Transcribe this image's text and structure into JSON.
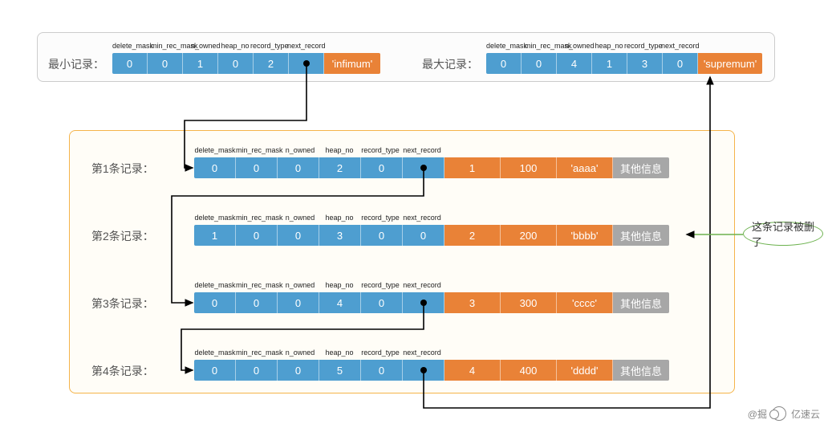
{
  "headers": [
    "delete_mask",
    "min_rec_mask",
    "n_owned",
    "heap_no",
    "record_type",
    "next_record"
  ],
  "top": {
    "min": {
      "label": "最小记录：",
      "cells": [
        "0",
        "0",
        "1",
        "0",
        "2",
        ""
      ],
      "tail": "'infimum'"
    },
    "max": {
      "label": "最大记录：",
      "cells": [
        "0",
        "0",
        "4",
        "1",
        "3",
        "0"
      ],
      "tail": "'supremum'"
    }
  },
  "records": [
    {
      "label": "第1条记录：",
      "blue": [
        "0",
        "0",
        "0",
        "2",
        "0",
        ""
      ],
      "orange": [
        "1",
        "100",
        "'aaaa'"
      ],
      "grey": "其他信息"
    },
    {
      "label": "第2条记录：",
      "blue": [
        "1",
        "0",
        "0",
        "3",
        "0",
        "0"
      ],
      "orange": [
        "2",
        "200",
        "'bbbb'"
      ],
      "grey": "其他信息"
    },
    {
      "label": "第3条记录：",
      "blue": [
        "0",
        "0",
        "0",
        "4",
        "0",
        ""
      ],
      "orange": [
        "3",
        "300",
        "'cccc'"
      ],
      "grey": "其他信息"
    },
    {
      "label": "第4条记录：",
      "blue": [
        "0",
        "0",
        "0",
        "5",
        "0",
        ""
      ],
      "orange": [
        "4",
        "400",
        "'dddd'"
      ],
      "grey": "其他信息"
    }
  ],
  "callout": "这条记录被删了",
  "colors": {
    "blue": "#4e9ed0",
    "orange": "#e98237",
    "grey": "#a7a7a7",
    "green": "#6db24f"
  },
  "watermark": {
    "left": "@掘",
    "right": "亿速云"
  }
}
